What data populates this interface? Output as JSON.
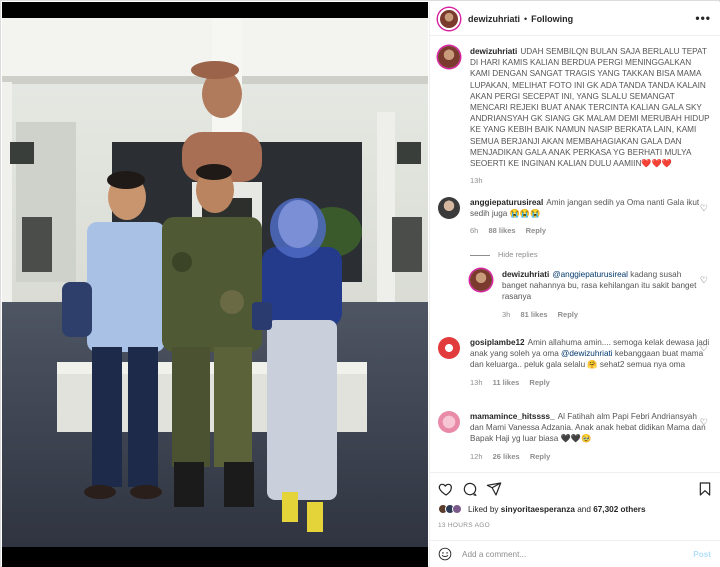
{
  "header": {
    "username": "dewizuhriati",
    "separator": "•",
    "follow_label": "Following",
    "more_label": "•••"
  },
  "caption": {
    "username": "dewizuhriati",
    "text": "UDAH SEMBILQN BULAN SAJA BERLALU TEPAT DI HARI KAMIS KALIAN BERDUA PERGI MENINGGALKAN KAMI DENGAN SANGAT TRAGIS YANG TAKKAN BISA MAMA LUPAKAN, MELIHAT FOTO INI GK ADA TANDA TANDA KALAIN AKAN PERGI SECEPAT INI, YANG SLALU SEMANGAT MENCARI REJEKI BUAT ANAK TERCINTA KALIAN GALA SKY ANDRIANSYAH GK SIANG GK MALAM DEMI MERUBAH HIDUP KE YANG KEBIH BAIK NAMUN NASIP BERKATA LAIN, KAMI SEMUA BERJANJI AKAN MEMBAHAGIAKAN GALA DAN MENJADIKAN GALA ANAK PERKASA YG BERHATI MULYA SEOERTI KE INGINAN KALIAN DULU AAMIIN",
    "emoji": "❤️❤️❤️",
    "time": "13h"
  },
  "comments": [
    {
      "username": "anggiepaturusireal",
      "text": "Amin jangan sedih ya Oma nanti Gala ikut sedih juga 😭😭😭",
      "time": "6h",
      "likes": "88 likes",
      "reply": "Reply"
    },
    {
      "username": "dewizuhriati",
      "mention": "@anggiepaturusireal",
      "text": "kadang susah banget nahannya bu, rasa kehilangan itu sakit banget rasanya",
      "time": "3h",
      "likes": "81 likes",
      "reply": "Reply"
    },
    {
      "username": "gosiplambe12",
      "text_a": "Amin allahuma amin.... semoga kelak dewasa jadi anak yang soleh ya oma",
      "mention": "@dewizuhriati",
      "text_b": "kebanggaan buat mama dan keluarga.. peluk gala selalu 🤗 sehat2 semua nya oma",
      "time": "13h",
      "likes": "11 likes",
      "reply": "Reply"
    },
    {
      "username": "mamamince_hitssss_",
      "text": "Al Fatihah alm Papi Febri Andriansyah dan Mami Vanessa Adzania. Anak anak hebat didikan Mama dan Bapak Haji yg luar biasa 🖤🖤🥹",
      "time": "12h",
      "likes": "26 likes",
      "reply": "Reply"
    }
  ],
  "hide_replies": "Hide replies",
  "likes_bar": {
    "prefix": "Liked by",
    "user": "sinyoritaesperanza",
    "and": "and",
    "others": "67,302 others",
    "ago": "13 HOURS AGO"
  },
  "add_comment": {
    "placeholder": "Add a comment...",
    "post_label": "Post"
  },
  "colors": {
    "accent": "#0095f6",
    "post_disabled": "#b2dffc",
    "heart_red": "#e0245e",
    "muted": "#8e8e8e"
  }
}
